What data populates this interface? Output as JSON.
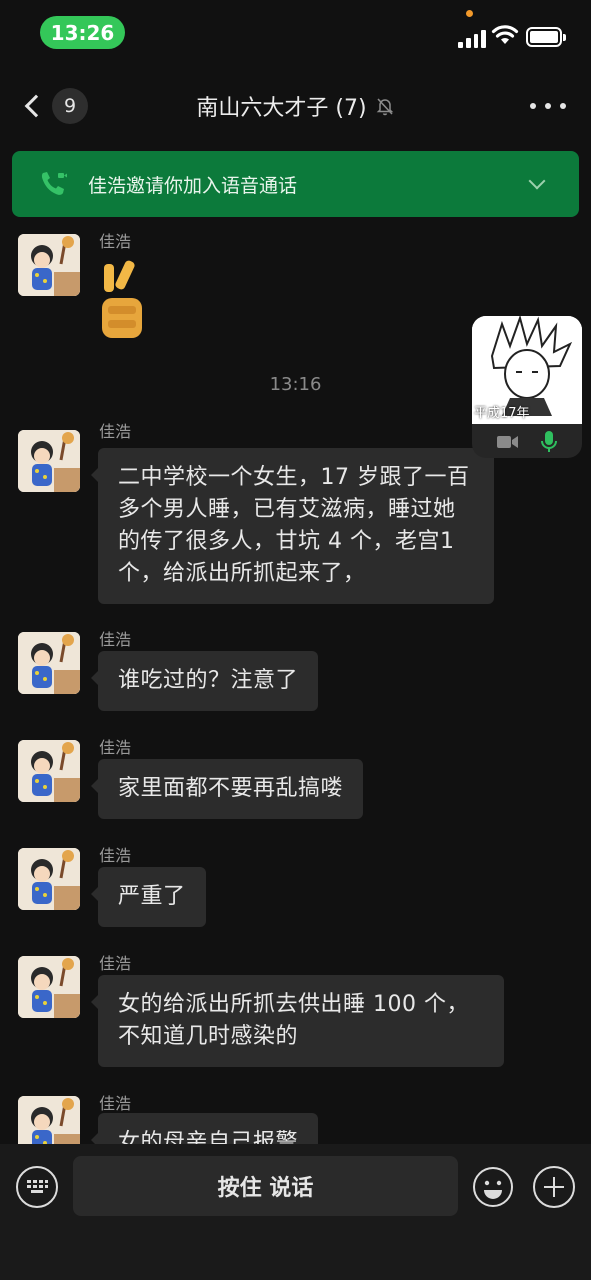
{
  "status_bar": {
    "time": "13:26"
  },
  "nav": {
    "unread_count": "9",
    "title": "南山六大才子 (7)"
  },
  "call_banner": {
    "text": "佳浩邀请你加入语音通话"
  },
  "timestamp": "13:16",
  "messages": [
    {
      "sender": "佳浩",
      "type": "sticker",
      "sticker": "victory-hand"
    },
    {
      "sender": "佳浩",
      "text": "二中学校一个女生，17 岁跟了一百多个男人睡，已有艾滋病，睡过她的传了很多人，甘坑 4 个，老宫1个，给派出所抓起来了，"
    },
    {
      "sender": "佳浩",
      "text": "谁吃过的？注意了"
    },
    {
      "sender": "佳浩",
      "text": "家里面都不要再乱搞喽"
    },
    {
      "sender": "佳浩",
      "text": "严重了"
    },
    {
      "sender": "佳浩",
      "text": "女的给派出所抓去供出睡 100 个，不知道几时感染的"
    },
    {
      "sender": "佳浩",
      "text": "女的母亲自己报警"
    }
  ],
  "float_window": {
    "caption": "平成17年"
  },
  "input_bar": {
    "hold_to_talk": "按住 说话"
  },
  "colors": {
    "accent_green": "#0c7a3b",
    "bubble": "#2c2c2c",
    "background": "#111111",
    "time_pill": "#34c759"
  }
}
